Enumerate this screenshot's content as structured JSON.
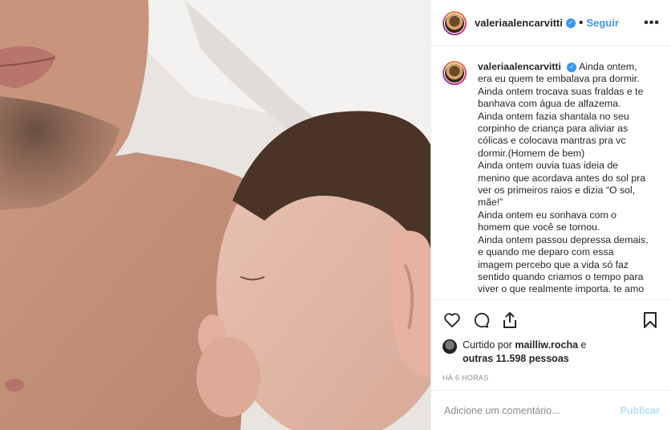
{
  "post": {
    "username": "valeriaalencarvitti",
    "follow_label": "Seguir",
    "dot": "•",
    "more_label": "•••",
    "verified_mark": "✓"
  },
  "caption": {
    "username": "valeriaalencarvitti",
    "lines": [
      "Ainda ontem,",
      "era eu quem te embalava pra dormir.",
      "Ainda ontem trocava suas fraldas e te",
      "banhava com água de alfazema.",
      "Ainda ontem fazia shantala no seu",
      "corpinho de criança para aliviar as",
      "cólicas e colocava mantras pra vc",
      "dormir.(Homem de bem)",
      "Ainda ontem ouvia tuas ideia de",
      "menino que acordava antes do sol pra",
      "ver os primeiros raios e dizia “O sol,",
      "mãe!”",
      "Ainda ontem eu sonhava com o",
      "homem que você se tornou.",
      "Ainda ontem passou depressa demais,",
      "e quando me deparo com essa",
      "imagem percebo que a vida só faz",
      "sentido quando criamos o tempo para",
      "viver o que realmente importa. te amo"
    ]
  },
  "actions": {
    "like_icon": "heart-icon",
    "comment_icon": "comment-icon",
    "share_icon": "share-icon",
    "save_icon": "bookmark-icon"
  },
  "likes": {
    "prefix": "Curtido por",
    "user": "mailliw.rocha",
    "middle": "e",
    "others": "outras 11.598 pessoas"
  },
  "timestamp": "HÁ 6 HORAS",
  "comment_box": {
    "placeholder": "Adicione um comentário...",
    "publish_label": "Publicar"
  },
  "colors": {
    "link_blue": "#3897f0",
    "publish_disabled": "#b2dffc",
    "muted_text": "#8e8e8e"
  }
}
